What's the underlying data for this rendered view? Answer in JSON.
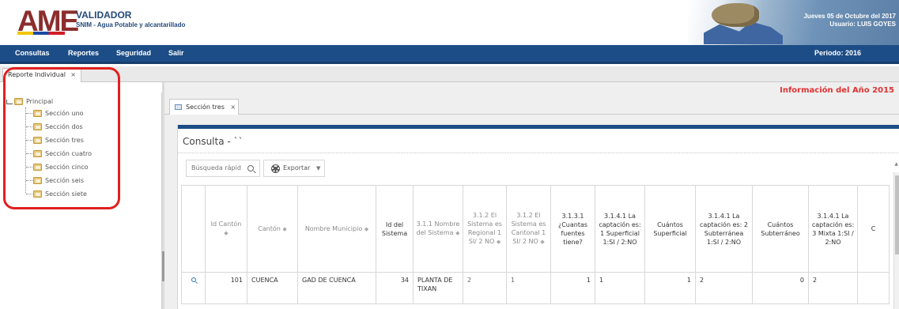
{
  "header": {
    "logo_text": "AME",
    "app_title": "VALIDADOR",
    "app_subtitle": "SNIM - Agua Potable y alcantarillado",
    "date_text": "Jueves 05 de Octubre del 2017",
    "user_text": "Usuario: LUIS GOYES"
  },
  "nav": {
    "items": [
      "Consultas",
      "Reportes",
      "Seguridad",
      "Salir"
    ],
    "periodo": "Periodo: 2016"
  },
  "outer_tab": {
    "label": "Reporte Individual",
    "close": "×"
  },
  "tree": {
    "root": "Principal",
    "items": [
      "Sección uno",
      "Sección dos",
      "Sección tres",
      "Sección cuatro",
      "Sección cinco",
      "Sección seis",
      "Sección siete"
    ]
  },
  "main": {
    "info_year": "Información del Año 2015",
    "inner_tab_label": "Sección tres",
    "inner_tab_close": "×",
    "consulta_title": "Consulta - ``",
    "search_placeholder": "Búsqueda rápid",
    "export_label": "Exportar"
  },
  "table": {
    "headers": [
      "",
      "Id Cantón",
      "Cantón",
      "Nombre Municipio",
      "Id del Sistema",
      "3.1.1 Nombre del Sistema",
      "3.1.2 El Sistema es Regional 1 SI/ 2 NO",
      "3.1.2 El Sistema es Cantonal 1 SI/ 2 NO",
      "3.1.3.1 ¿Cuantas fuentes tiene?",
      "3.1.4.1 La captación es: 1 Superficial 1:SI / 2:NO",
      "Cuántos Superficial",
      "3.1.4.1 La captación es: 2 Subterránea 1:SI / 2:NO",
      "Cuántos Subterráneo",
      "3.1.4.1 La captación es: 3 Mixta 1:SI / 2:NO",
      "C"
    ],
    "rows": [
      [
        "",
        "101",
        "CUENCA",
        "GAD DE CUENCA",
        "34",
        "PLANTA DE TIXAN",
        "2",
        "1",
        "1",
        "1",
        "1",
        "2",
        "0",
        "2",
        ""
      ]
    ]
  }
}
